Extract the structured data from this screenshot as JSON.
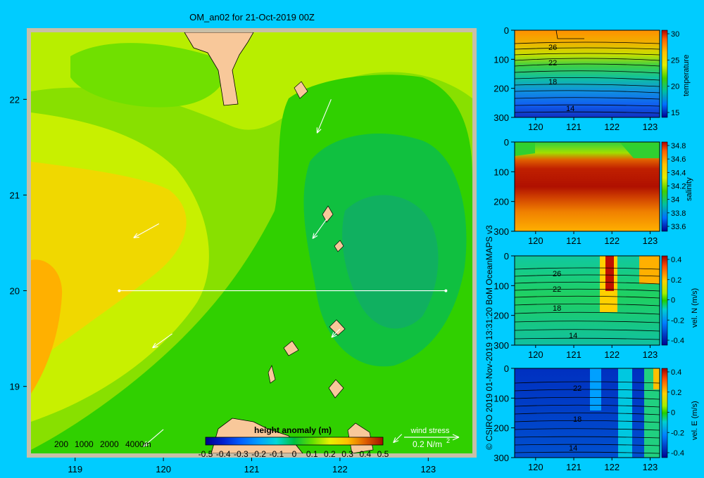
{
  "title": "OM_an02 for 21-Oct-2019 00Z",
  "credit": "© CSIRO 2019   01-Nov-2019 13:31:20 BoM OceanMAPS v3",
  "chart_data": [
    {
      "type": "heatmap",
      "panel": "map",
      "x_ticks": [
        "119",
        "120",
        "121",
        "122",
        "123"
      ],
      "y_ticks": [
        "22",
        "21",
        "20",
        "19"
      ],
      "xlim": [
        118.5,
        123.5
      ],
      "ylim": [
        18.3,
        22.7
      ],
      "colorbar": {
        "title": "height anomaly  (m)",
        "ticks": [
          "-0.5",
          "-0.4",
          "-0.3",
          "-0.2",
          "-0.1",
          "0",
          "0.1",
          "0.2",
          "0.3",
          "0.4",
          "0.5"
        ],
        "colors": [
          "#00008b",
          "#0020d0",
          "#0060ff",
          "#00a0ff",
          "#00d8d8",
          "#00c040",
          "#40e000",
          "#a0f000",
          "#e8f000",
          "#ffc000",
          "#ff8000",
          "#e04000",
          "#b01000"
        ]
      },
      "depth_legend": [
        "200",
        "1000",
        "2000",
        "4000m"
      ],
      "wind_stress_legend": {
        "label": "wind stress",
        "value": "0.2 N/m",
        "sup": "2"
      },
      "section_line": {
        "lon": [
          119.5,
          123.2
        ],
        "lat": 20.0
      },
      "wind_vectors": [
        {
          "lon": 121.9,
          "lat": 22.0,
          "u": -0.05,
          "v": -0.12
        },
        {
          "lon": 119.95,
          "lat": 20.7,
          "u": -0.09,
          "v": -0.05
        },
        {
          "lon": 121.85,
          "lat": 20.75,
          "u": -0.05,
          "v": -0.07
        },
        {
          "lon": 120.1,
          "lat": 19.55,
          "u": -0.07,
          "v": -0.05
        },
        {
          "lon": 122.0,
          "lat": 19.6,
          "u": -0.03,
          "v": -0.03
        },
        {
          "lon": 120.0,
          "lat": 18.55,
          "u": -0.07,
          "v": -0.06
        },
        {
          "lon": 122.7,
          "lat": 18.5,
          "u": -0.03,
          "v": -0.03
        }
      ]
    },
    {
      "type": "heatmap",
      "panel": "temperature-section",
      "x_ticks": [
        "120",
        "121",
        "122",
        "123"
      ],
      "y_ticks": [
        "0",
        "100",
        "200",
        "300"
      ],
      "contour_labels": [
        "26",
        "22",
        "18",
        "14"
      ],
      "colorbar": {
        "label": "temperature",
        "ticks": [
          "30",
          "25",
          "20",
          "15"
        ]
      }
    },
    {
      "type": "heatmap",
      "panel": "salinity-section",
      "x_ticks": [
        "120",
        "121",
        "122",
        "123"
      ],
      "y_ticks": [
        "0",
        "100",
        "200",
        "300"
      ],
      "colorbar": {
        "label": "salinity",
        "ticks": [
          "34.8",
          "34.6",
          "34.4",
          "34.2",
          "34",
          "33.8",
          "33.6"
        ]
      }
    },
    {
      "type": "heatmap",
      "panel": "velocity-north-section",
      "x_ticks": [
        "120",
        "121",
        "122",
        "123"
      ],
      "y_ticks": [
        "0",
        "100",
        "200",
        "300"
      ],
      "contour_labels": [
        "26",
        "22",
        "18",
        "14"
      ],
      "colorbar": {
        "label": "vel. N (m/s)",
        "ticks": [
          "0.4",
          "0.2",
          "0",
          "-0.2",
          "-0.4"
        ]
      }
    },
    {
      "type": "heatmap",
      "panel": "velocity-east-section",
      "x_ticks": [
        "120",
        "121",
        "122",
        "123"
      ],
      "y_ticks": [
        "0",
        "100",
        "200",
        "300"
      ],
      "contour_labels": [
        "22",
        "18",
        "14"
      ],
      "colorbar": {
        "label": "vel. E (m/s)",
        "ticks": [
          "0.4",
          "0.2",
          "0",
          "-0.2",
          "-0.4"
        ]
      }
    }
  ]
}
